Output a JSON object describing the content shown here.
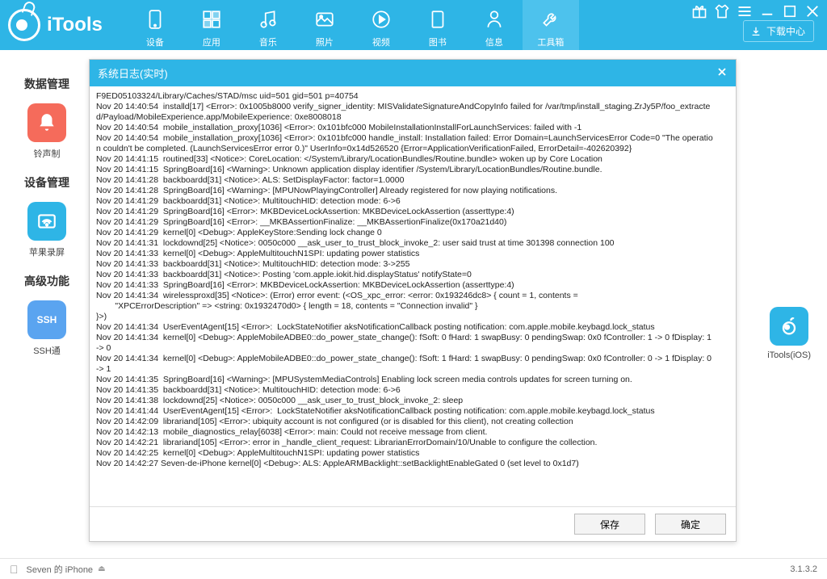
{
  "app": {
    "name": "iTools"
  },
  "nav": [
    {
      "label": "设备",
      "icon": "device"
    },
    {
      "label": "应用",
      "icon": "app"
    },
    {
      "label": "音乐",
      "icon": "music"
    },
    {
      "label": "照片",
      "icon": "photo"
    },
    {
      "label": "视频",
      "icon": "video"
    },
    {
      "label": "图书",
      "icon": "book"
    },
    {
      "label": "信息",
      "icon": "info"
    },
    {
      "label": "工具箱",
      "icon": "tools",
      "active": true
    }
  ],
  "download_center": "下载中心",
  "sidebar": {
    "sec1": {
      "title": "数据管理",
      "item": "铃声制"
    },
    "sec2": {
      "title": "设备管理",
      "item": "苹果录屏"
    },
    "sec3": {
      "title": "高级功能",
      "item": "SSH通"
    }
  },
  "right_item": {
    "label": "iTools(iOS)"
  },
  "dialog": {
    "title": "系统日志(实时)",
    "save": "保存",
    "ok": "确定",
    "log": [
      "F9ED05103324/Library/Caches/STAD/msc uid=501 gid=501 p=40754",
      "Nov 20 14:40:54  installd[17] <Error>: 0x1005b8000 verify_signer_identity: MISValidateSignatureAndCopyInfo failed for /var/tmp/install_staging.ZrJy5P/foo_extracted/Payload/MobileExperience.app/MobileExperience: 0xe8008018",
      "Nov 20 14:40:54  mobile_installation_proxy[1036] <Error>: 0x101bfc000 MobileInstallationInstallForLaunchServices: failed with -1",
      "Nov 20 14:40:54  mobile_installation_proxy[1036] <Error>: 0x101bfc000 handle_install: Installation failed: Error Domain=LaunchServicesError Code=0 \"The operation couldn't be completed. (LaunchServicesError error 0.)\" UserInfo=0x14d526520 {Error=ApplicationVerificationFailed, ErrorDetail=-402620392}",
      "Nov 20 14:41:15  routined[33] <Notice>: CoreLocation: </System/Library/LocationBundles/Routine.bundle> woken up by Core Location",
      "Nov 20 14:41:15  SpringBoard[16] <Warning>: Unknown application display identifier /System/Library/LocationBundles/Routine.bundle.",
      "Nov 20 14:41:28  backboardd[31] <Notice>: ALS: SetDisplayFactor: factor=1.0000",
      "Nov 20 14:41:28  SpringBoard[16] <Warning>: [MPUNowPlayingController] Already registered for now playing notifications.",
      "Nov 20 14:41:29  backboardd[31] <Notice>: MultitouchHID: detection mode: 6->6",
      "Nov 20 14:41:29  SpringBoard[16] <Error>: MKBDeviceLockAssertion: MKBDeviceLockAssertion (asserttype:4)",
      "Nov 20 14:41:29  SpringBoard[16] <Error>: __MKBAssertionFinalize: __MKBAssertionFinalize(0x170a21d40)",
      "Nov 20 14:41:29  kernel[0] <Debug>: AppleKeyStore:Sending lock change 0",
      "Nov 20 14:41:31  lockdownd[25] <Notice>: 0050c000 __ask_user_to_trust_block_invoke_2: user said trust at time 301398 connection 100",
      "Nov 20 14:41:33  kernel[0] <Debug>: AppleMultitouchN1SPI: updating power statistics",
      "Nov 20 14:41:33  backboardd[31] <Notice>: MultitouchHID: detection mode: 3->255",
      "Nov 20 14:41:33  backboardd[31] <Notice>: Posting 'com.apple.iokit.hid.displayStatus' notifyState=0",
      "Nov 20 14:41:33  SpringBoard[16] <Error>: MKBDeviceLockAssertion: MKBDeviceLockAssertion (asserttype:4)",
      "Nov 20 14:41:34  wirelessproxd[35] <Notice>: (Error) error event: (<OS_xpc_error: <error: 0x193246dc8> { count = 1, contents =\n\t\"XPCErrorDescription\" => <string: 0x1932470d0> { length = 18, contents = \"Connection invalid\" }\n}>)",
      "Nov 20 14:41:34  UserEventAgent[15] <Error>:  LockStateNotifier aksNotificationCallback posting notification: com.apple.mobile.keybagd.lock_status",
      "Nov 20 14:41:34  kernel[0] <Debug>: AppleMobileADBE0::do_power_state_change(): fSoft: 0 fHard: 1 swapBusy: 0 pendingSwap: 0x0 fController: 1 -> 0 fDisplay: 1 -> 0",
      "Nov 20 14:41:34  kernel[0] <Debug>: AppleMobileADBE0::do_power_state_change(): fSoft: 1 fHard: 1 swapBusy: 0 pendingSwap: 0x0 fController: 0 -> 1 fDisplay: 0 -> 1",
      "Nov 20 14:41:35  SpringBoard[16] <Warning>: [MPUSystemMediaControls] Enabling lock screen media controls updates for screen turning on.",
      "Nov 20 14:41:35  backboardd[31] <Notice>: MultitouchHID: detection mode: 6->6",
      "Nov 20 14:41:38  lockdownd[25] <Notice>: 0050c000 __ask_user_to_trust_block_invoke_2: sleep",
      "Nov 20 14:41:44  UserEventAgent[15] <Error>:  LockStateNotifier aksNotificationCallback posting notification: com.apple.mobile.keybagd.lock_status",
      "Nov 20 14:42:09  librariand[105] <Error>: ubiquity account is not configured (or is disabled for this client), not creating collection",
      "Nov 20 14:42:13  mobile_diagnostics_relay[6038] <Error>: main: Could not receive message from client.",
      "Nov 20 14:42:21  librariand[105] <Error>: error in _handle_client_request: LibrarianErrorDomain/10/Unable to configure the collection.",
      "Nov 20 14:42:25  kernel[0] <Debug>: AppleMultitouchN1SPI: updating power statistics",
      "Nov 20 14:42:27 Seven-de-iPhone kernel[0] <Debug>: ALS: AppleARMBacklight::setBacklightEnableGated 0 (set level to 0x1d7)"
    ]
  },
  "status": {
    "device": "Seven 的 iPhone",
    "version": "3.1.3.2"
  }
}
